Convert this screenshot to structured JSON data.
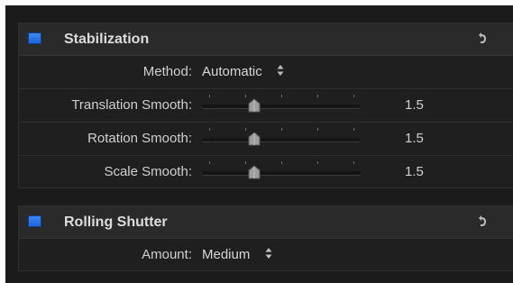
{
  "sections": [
    {
      "title": "Stabilization",
      "enabled": true,
      "reset_icon": "reset-arrow-icon",
      "method": {
        "label": "Method:",
        "value": "Automatic"
      },
      "sliders": [
        {
          "label": "Translation Smooth:",
          "value": "1.5",
          "level": 0.33
        },
        {
          "label": "Rotation Smooth:",
          "value": "1.5",
          "level": 0.33
        },
        {
          "label": "Scale Smooth:",
          "value": "1.5",
          "level": 0.33
        }
      ]
    },
    {
      "title": "Rolling Shutter",
      "enabled": true,
      "reset_icon": "reset-arrow-icon",
      "amount": {
        "label": "Amount:",
        "value": "Medium"
      }
    }
  ],
  "colors": {
    "checkbox": "#2f7ae8",
    "panel_background": "#1f1f20",
    "header_background": "#2a2a2b"
  }
}
